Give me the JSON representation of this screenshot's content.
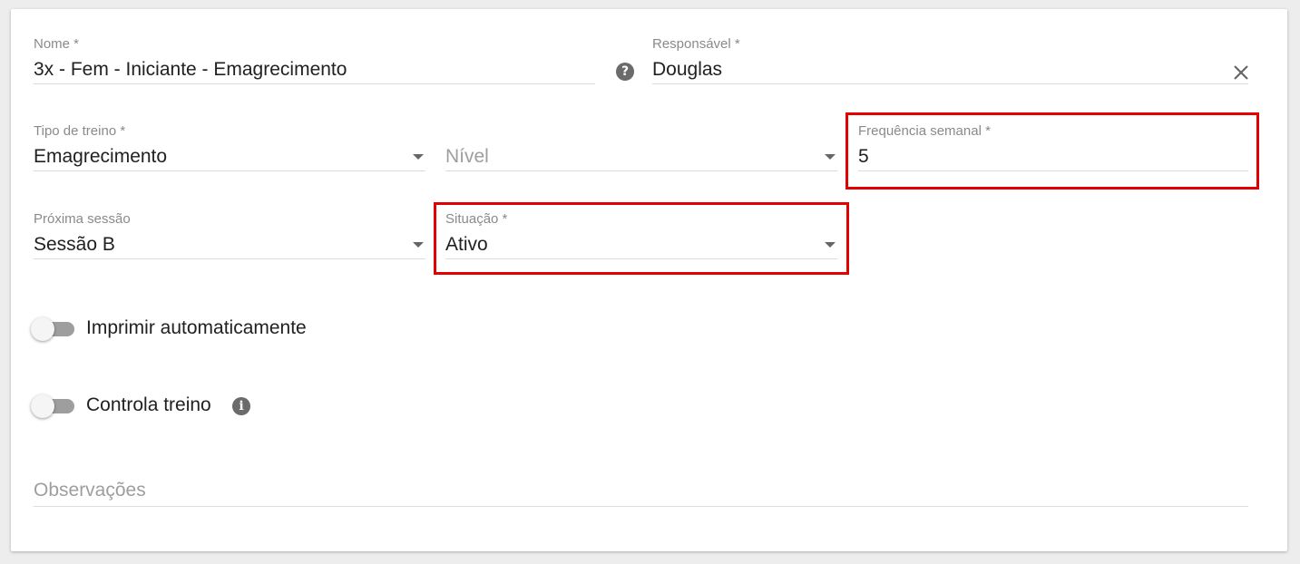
{
  "form": {
    "nome": {
      "label": "Nome *",
      "value": "3x - Fem - Iniciante - Emagrecimento",
      "help_icon": "help-circle-icon"
    },
    "responsavel": {
      "label": "Responsável *",
      "value": "Douglas",
      "clear_icon": "close-icon"
    },
    "tipo_treino": {
      "label": "Tipo de treino *",
      "value": "Emagrecimento"
    },
    "nivel": {
      "placeholder": "Nível"
    },
    "frequencia": {
      "label": "Frequência semanal *",
      "value": "5"
    },
    "proxima_sessao": {
      "label": "Próxima sessão",
      "value": "Sessão B"
    },
    "situacao": {
      "label": "Situação *",
      "value": "Ativo"
    },
    "imprimir": {
      "label": "Imprimir automaticamente",
      "checked": false
    },
    "controla_treino": {
      "label": "Controla treino",
      "checked": false,
      "info_icon": "info-icon"
    },
    "observacoes": {
      "placeholder": "Observações"
    }
  },
  "highlight_color": "#e30000"
}
